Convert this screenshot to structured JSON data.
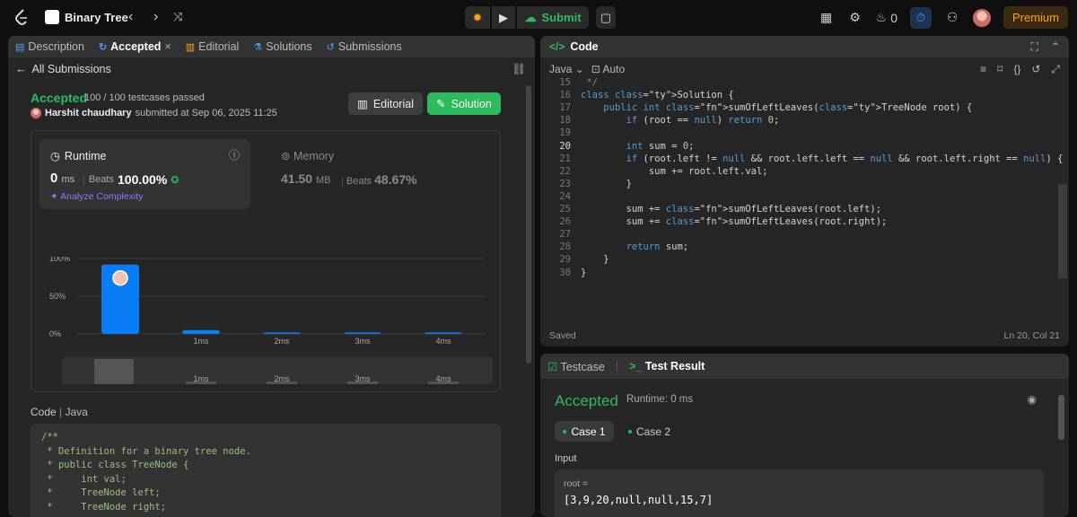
{
  "topbar": {
    "problem_title": "Binary Tree",
    "submit_label": "Submit",
    "streak_count": "0",
    "premium_label": "Premium"
  },
  "left_panel": {
    "tabs": [
      {
        "label": "Description"
      },
      {
        "label": "Accepted"
      },
      {
        "label": "Editorial"
      },
      {
        "label": "Solutions"
      },
      {
        "label": "Submissions"
      }
    ],
    "back_label": "All Submissions",
    "status": "Accepted",
    "testcases": "100 / 100 testcases passed",
    "user": "Harshit chaudhary",
    "submitted_at": "submitted at Sep 06, 2025 11:25",
    "editorial_btn": "Editorial",
    "solution_btn": "Solution",
    "runtime": {
      "title": "Runtime",
      "value": "0",
      "unit": "ms",
      "beats_label": "Beats",
      "beats_value": "100.00%",
      "analyze": "Analyze Complexity"
    },
    "memory": {
      "title": "Memory",
      "value": "41.50",
      "unit": "MB",
      "beats_label": "Beats",
      "beats_value": "48.67%"
    },
    "code_label": "Code",
    "code_lang": "Java",
    "code_snippet": "/**\n * Definition for a binary tree node.\n * public class TreeNode {\n *     int val;\n *     TreeNode left;\n *     TreeNode right;"
  },
  "chart_data": {
    "type": "bar",
    "categories": [
      "0ms",
      "1ms",
      "2ms",
      "3ms",
      "4ms"
    ],
    "x_tick_labels": [
      "",
      "1ms",
      "2ms",
      "3ms",
      "4ms"
    ],
    "values": [
      92,
      5,
      2,
      2,
      2
    ],
    "y_ticks": [
      "100%",
      "50%",
      "0%"
    ],
    "ylim": [
      0,
      100
    ],
    "bar_color": "#0a7cf5",
    "highlight_index": 0
  },
  "code_panel": {
    "title": "Code",
    "language": "Java",
    "mode": "Auto",
    "status": "Saved",
    "cursor": "Ln 20, Col 21"
  },
  "editor_lines": [
    {
      "n": "15",
      "t": " */"
    },
    {
      "n": "16",
      "t": "class Solution {"
    },
    {
      "n": "17",
      "t": "    public int sumOfLeftLeaves(TreeNode root) {"
    },
    {
      "n": "18",
      "t": "        if (root == null) return 0;"
    },
    {
      "n": "19",
      "t": ""
    },
    {
      "n": "20",
      "t": "        int sum = 0;"
    },
    {
      "n": "21",
      "t": "        if (root.left != null && root.left.left == null && root.left.right == null) {"
    },
    {
      "n": "22",
      "t": "            sum += root.left.val;"
    },
    {
      "n": "23",
      "t": "        }"
    },
    {
      "n": "24",
      "t": ""
    },
    {
      "n": "25",
      "t": "        sum += sumOfLeftLeaves(root.left);"
    },
    {
      "n": "26",
      "t": "        sum += sumOfLeftLeaves(root.right);"
    },
    {
      "n": "27",
      "t": ""
    },
    {
      "n": "28",
      "t": "        return sum;"
    },
    {
      "n": "29",
      "t": "    }"
    },
    {
      "n": "30",
      "t": "}"
    }
  ],
  "result_panel": {
    "tab_testcase": "Testcase",
    "tab_result": "Test Result",
    "status": "Accepted",
    "runtime": "Runtime: 0 ms",
    "case1": "Case 1",
    "case2": "Case 2",
    "input_label": "Input",
    "var_name": "root =",
    "var_value": "[3,9,20,null,null,15,7]"
  },
  "colors": {
    "accent_green": "#2cbb5d",
    "accent_orange": "#ffa116",
    "bar_blue": "#0a7cf5"
  }
}
